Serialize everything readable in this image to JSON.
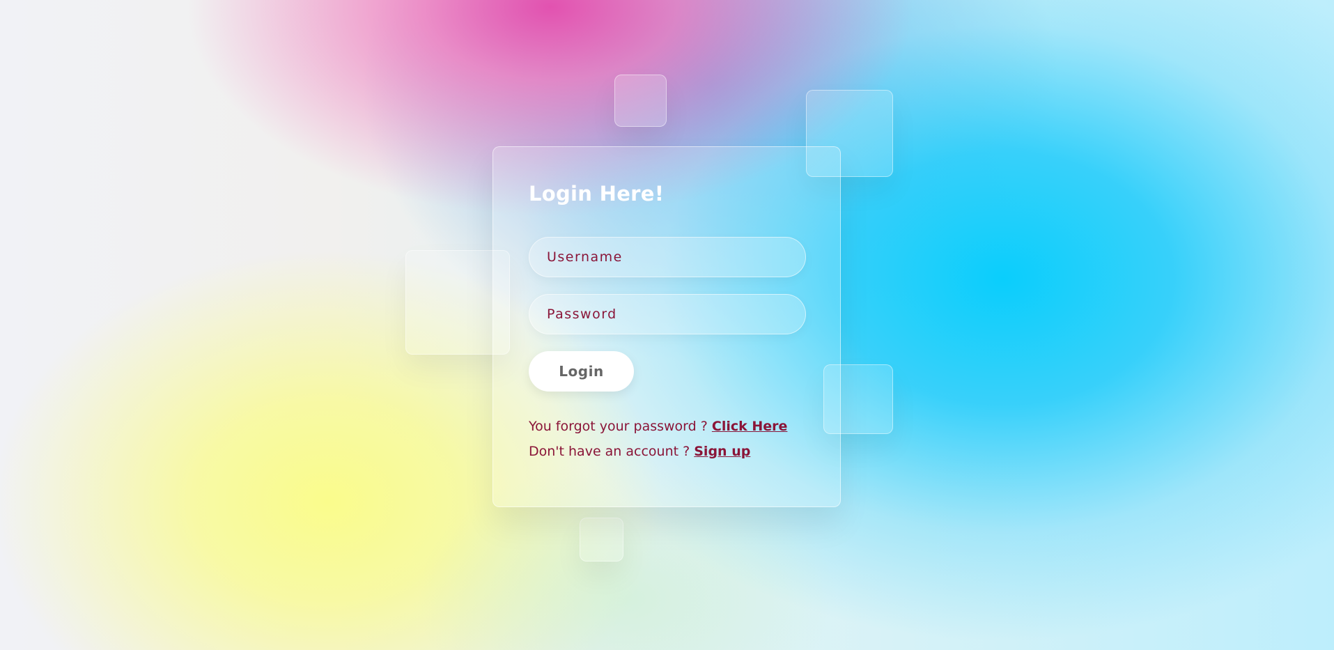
{
  "login_card": {
    "title": "Login Here!",
    "username_placeholder": "Username",
    "password_placeholder": "Password",
    "login_button": "Login",
    "forgot_text": "You forgot your password ? ",
    "forgot_link": "Click Here",
    "signup_text": "Don't have an account ? ",
    "signup_link": "Sign up"
  },
  "colors": {
    "text_accent": "#8a1538",
    "button_bg": "#ffffff",
    "button_text": "#666666",
    "bg_yellow": "#fafc8c",
    "bg_pink": "#e252b0",
    "bg_cyan": "#0acefc"
  }
}
